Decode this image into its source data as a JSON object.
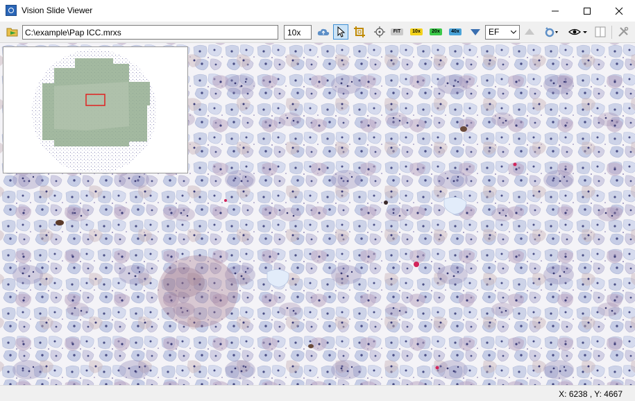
{
  "window": {
    "title": "Vision Slide Viewer",
    "controls": [
      "minimize",
      "maximize",
      "close"
    ]
  },
  "toolbar": {
    "file_path": "C:\\example\\Pap ICC.mrxs",
    "zoom_level": "10x",
    "magnification_buttons": [
      {
        "label": "FIT",
        "color": "#c9c9c9"
      },
      {
        "label": "10x",
        "color": "#f3d21b"
      },
      {
        "label": "20x",
        "color": "#3cc94a"
      },
      {
        "label": "40x",
        "color": "#4aa3d8"
      }
    ],
    "filter_select": "EF",
    "icons": [
      "open-folder-icon",
      "cloud-icon",
      "pointer-icon",
      "crop-icon",
      "target-icon",
      "triangle-down-icon",
      "triangle-up-icon",
      "rotate-icon",
      "eye-icon",
      "split-view-icon",
      "tools-icon"
    ]
  },
  "overview": {
    "region_indicator_color": "#e02020"
  },
  "status": {
    "coordinates": "X: 6238 , Y: 4667"
  },
  "colors": {
    "slide_background": "#f4f3f7",
    "cell_fill": "#c8cfe6",
    "nucleus": "#4a4f86",
    "highlight": "#cfe1f7"
  }
}
